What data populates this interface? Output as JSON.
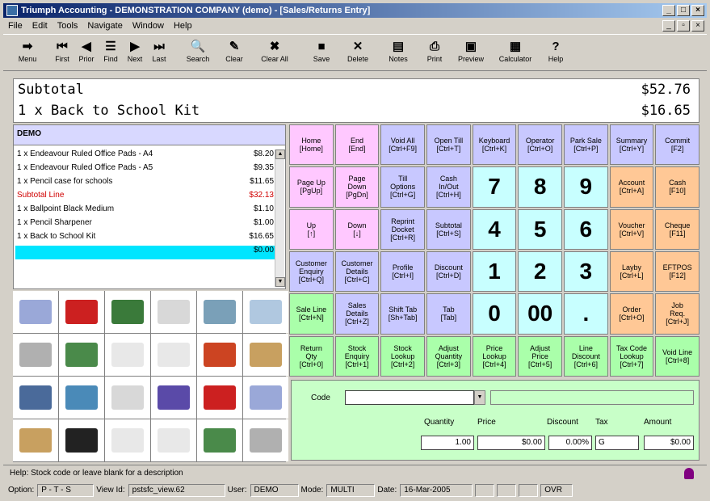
{
  "window": {
    "title": "Triumph Accounting - DEMONSTRATION COMPANY (demo) - [Sales/Returns Entry]"
  },
  "menu": [
    "File",
    "Edit",
    "Tools",
    "Navigate",
    "Window",
    "Help"
  ],
  "toolbar": [
    {
      "label": "Menu",
      "icon": "arrow-right-icon"
    },
    {
      "label": "First",
      "icon": "first-icon"
    },
    {
      "label": "Prior",
      "icon": "prior-icon"
    },
    {
      "label": "Find",
      "icon": "find-icon"
    },
    {
      "label": "Next",
      "icon": "next-icon"
    },
    {
      "label": "Last",
      "icon": "last-icon"
    },
    {
      "label": "Search",
      "icon": "search-icon"
    },
    {
      "label": "Clear",
      "icon": "clear-icon"
    },
    {
      "label": "Clear All",
      "icon": "clear-all-icon"
    },
    {
      "label": "Save",
      "icon": "save-icon"
    },
    {
      "label": "Delete",
      "icon": "delete-icon"
    },
    {
      "label": "Notes",
      "icon": "notes-icon"
    },
    {
      "label": "Print",
      "icon": "print-icon"
    },
    {
      "label": "Preview",
      "icon": "preview-icon"
    },
    {
      "label": "Calculator",
      "icon": "calculator-icon"
    },
    {
      "label": "Help",
      "icon": "help-icon"
    }
  ],
  "display": {
    "line1_label": "Subtotal",
    "line1_value": "$52.76",
    "line2_label": "1 x Back to School Kit",
    "line2_value": "$16.65"
  },
  "sale": {
    "header": "DEMO",
    "items": [
      {
        "desc": "1 x Endeavour Ruled Office Pads - A4",
        "amount": "$8.20"
      },
      {
        "desc": "1 x Endeavour Ruled Office Pads - A5",
        "amount": "$9.35"
      },
      {
        "desc": "1 x Pencil case for schools",
        "amount": "$11.65"
      },
      {
        "desc": "Subtotal Line",
        "amount": "$32.13",
        "red": true
      },
      {
        "desc": "1 x Ballpoint Black Medium",
        "amount": "$1.10"
      },
      {
        "desc": "1 x Pencil Sharpener",
        "amount": "$1.00"
      },
      {
        "desc": "1 x Back to School Kit",
        "amount": "$16.65"
      },
      {
        "desc": "",
        "amount": "$0.00",
        "selected": true
      }
    ]
  },
  "keys": [
    {
      "label": "Home\n[Home]",
      "color": "pink"
    },
    {
      "label": "End\n[End]",
      "color": "pink"
    },
    {
      "label": "Void All\n[Ctrl+F9]",
      "color": "lav"
    },
    {
      "label": "Open Till\n[Ctrl+T]",
      "color": "lav"
    },
    {
      "label": "Keyboard\n[Ctrl+K]",
      "color": "lav"
    },
    {
      "label": "Operator\n[Ctrl+O]",
      "color": "lav"
    },
    {
      "label": "Park Sale\n[Ctrl+P]",
      "color": "lav"
    },
    {
      "label": "Summary\n[Ctrl+Y]",
      "color": "lav"
    },
    {
      "label": "Commit\n[F2]",
      "color": "lav"
    },
    {
      "label": "Page Up\n[PgUp]",
      "color": "pink"
    },
    {
      "label": "Page\nDown\n[PgDn]",
      "color": "pink"
    },
    {
      "label": "Till\nOptions\n[Ctrl+G]",
      "color": "lav"
    },
    {
      "label": "Cash\nIn/Out\n[Ctrl+H]",
      "color": "lav"
    },
    {
      "label": "7",
      "color": "cyan",
      "big": true
    },
    {
      "label": "8",
      "color": "cyan",
      "big": true
    },
    {
      "label": "9",
      "color": "cyan",
      "big": true
    },
    {
      "label": "Account\n[Ctrl+A]",
      "color": "orange"
    },
    {
      "label": "Cash\n[F10]",
      "color": "orange"
    },
    {
      "label": "Up\n[↑]",
      "color": "pink"
    },
    {
      "label": "Down\n[↓]",
      "color": "pink"
    },
    {
      "label": "Reprint\nDocket\n[Ctrl+R]",
      "color": "lav"
    },
    {
      "label": "Subtotal\n[Ctrl+S]",
      "color": "lav"
    },
    {
      "label": "4",
      "color": "cyan",
      "big": true
    },
    {
      "label": "5",
      "color": "cyan",
      "big": true
    },
    {
      "label": "6",
      "color": "cyan",
      "big": true
    },
    {
      "label": "Voucher\n[Ctrl+V]",
      "color": "orange"
    },
    {
      "label": "Cheque\n[F11]",
      "color": "orange"
    },
    {
      "label": "Customer\nEnquiry\n[Ctrl+Q]",
      "color": "lav"
    },
    {
      "label": "Customer\nDetails\n[Ctrl+C]",
      "color": "lav"
    },
    {
      "label": "Profile\n[Ctrl+I]",
      "color": "lav"
    },
    {
      "label": "Discount\n[Ctrl+D]",
      "color": "lav"
    },
    {
      "label": "1",
      "color": "cyan",
      "big": true
    },
    {
      "label": "2",
      "color": "cyan",
      "big": true
    },
    {
      "label": "3",
      "color": "cyan",
      "big": true
    },
    {
      "label": "Layby\n[Ctrl+L]",
      "color": "orange"
    },
    {
      "label": "EFTPOS\n[F12]",
      "color": "orange"
    },
    {
      "label": "Sale Line\n[Ctrl+N]",
      "color": "green"
    },
    {
      "label": "Sales\nDetails\n[Ctrl+Z]",
      "color": "lav"
    },
    {
      "label": "Shift Tab\n[Sh+Tab]",
      "color": "lav"
    },
    {
      "label": "Tab\n[Tab]",
      "color": "lav"
    },
    {
      "label": "0",
      "color": "cyan",
      "big": true
    },
    {
      "label": "00",
      "color": "cyan",
      "big": true
    },
    {
      "label": ".",
      "color": "cyan",
      "big": true
    },
    {
      "label": "Order\n[Ctrl+O]",
      "color": "orange"
    },
    {
      "label": "Job\nReq.\n[Ctrl+J]",
      "color": "orange"
    },
    {
      "label": "Return\nQty\n[Ctrl+0]",
      "color": "green"
    },
    {
      "label": "Stock\nEnquiry\n[Ctrl+1]",
      "color": "green"
    },
    {
      "label": "Stock\nLookup\n[Ctrl+2]",
      "color": "green"
    },
    {
      "label": "Adjust\nQuantity\n[Ctrl+3]",
      "color": "green"
    },
    {
      "label": "Price\nLookup\n[Ctrl+4]",
      "color": "green"
    },
    {
      "label": "Adjust\nPrice\n[Ctrl+5]",
      "color": "green"
    },
    {
      "label": "Line\nDiscount\n[Ctrl+6]",
      "color": "green"
    },
    {
      "label": "Tax Code\nLookup\n[Ctrl+7]",
      "color": "green"
    },
    {
      "label": "Void Line\n[Ctrl+8]",
      "color": "green"
    }
  ],
  "entry": {
    "code_label": "Code",
    "quantity_label": "Quantity",
    "price_label": "Price",
    "discount_label": "Discount",
    "tax_label": "Tax",
    "amount_label": "Amount",
    "quantity": "1.00",
    "price": "$0.00",
    "discount": "0.00%",
    "tax": "G",
    "amount": "$0.00"
  },
  "help": {
    "text": "Help:   Stock code or leave blank for a description"
  },
  "status": {
    "option_label": "Option:",
    "option_value": "P - T - S",
    "view_label": "View Id:",
    "view_value": "pstsfc_view.62",
    "user_label": "User:",
    "user_value": "DEMO",
    "mode_label": "Mode:",
    "mode_value": "MULTI",
    "date_label": "Date:",
    "date_value": "16-Mar-2005",
    "ovr": "OVR"
  },
  "colors": {
    "pink": "#ffc8ff",
    "lav": "#c8c8ff",
    "cyan": "#c8ffff",
    "orange": "#ffc896",
    "green": "#aaffaa"
  }
}
